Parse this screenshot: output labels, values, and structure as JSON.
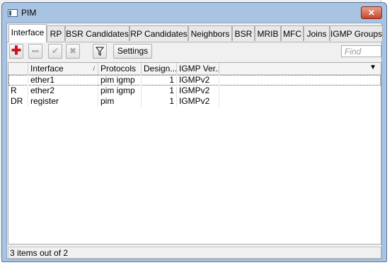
{
  "window": {
    "title": "PIM",
    "close_label": "✕"
  },
  "tabs": [
    {
      "label": "Interface",
      "active": true
    },
    {
      "label": "RP"
    },
    {
      "label": "BSR Candidates"
    },
    {
      "label": "RP Candidates"
    },
    {
      "label": "Neighbors"
    },
    {
      "label": "BSR"
    },
    {
      "label": "MRIB"
    },
    {
      "label": "MFC"
    },
    {
      "label": "Joins"
    },
    {
      "label": "IGMP Groups"
    }
  ],
  "toolbar": {
    "settings_label": "Settings",
    "find_placeholder": "Find"
  },
  "table": {
    "columns": [
      "",
      "Interface",
      "Protocols",
      "Design...",
      "IGMP Ver..."
    ],
    "rows": [
      {
        "flag": "",
        "interface": "ether1",
        "protocols": "pim igmp",
        "designated": "1",
        "igmp": "IGMPv2"
      },
      {
        "flag": "R",
        "interface": "ether2",
        "protocols": "pim igmp",
        "designated": "1",
        "igmp": "IGMPv2"
      },
      {
        "flag": "DR",
        "interface": "register",
        "protocols": "pim",
        "designated": "1",
        "igmp": "IGMPv2"
      }
    ]
  },
  "status": {
    "text": "3 items out of 2"
  },
  "colors": {
    "titlebar": "#a9c4e3",
    "add_icon": "#d0121b"
  }
}
